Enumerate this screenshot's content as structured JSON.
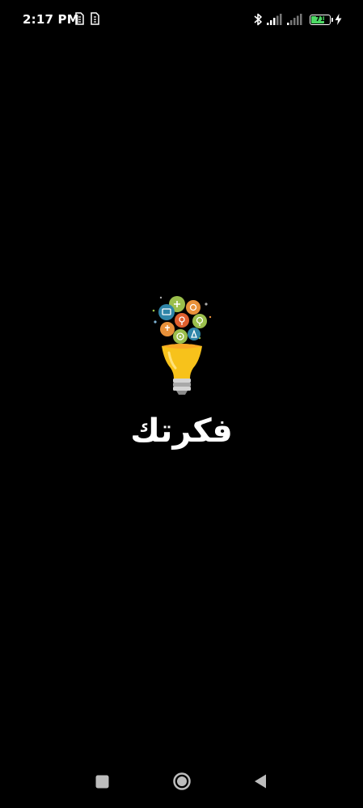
{
  "status_bar": {
    "time": "2:17 PM",
    "notification_icons": [
      "sim-icon",
      "sim-icon"
    ],
    "battery_level": "71",
    "battery_percent": 71,
    "battery_color": "#4cd964",
    "icons": [
      "bluetooth-icon",
      "signal-icon",
      "signal-icon",
      "battery-icon",
      "charging-icon"
    ]
  },
  "splash": {
    "logo": "lightbulb-ideas-icon",
    "app_name": "فكرتك"
  },
  "nav_bar": {
    "icons": [
      "recents-icon",
      "home-icon",
      "back-icon"
    ]
  }
}
